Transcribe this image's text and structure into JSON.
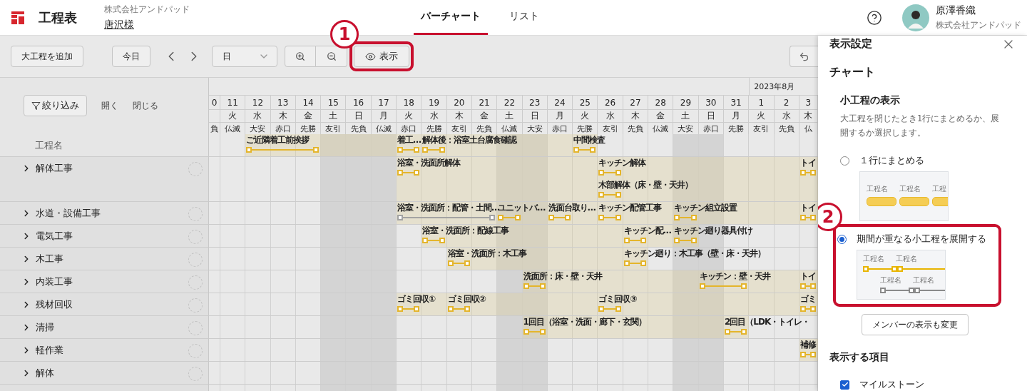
{
  "header": {
    "app_title": "工程表",
    "company": "株式会社アンドパッド",
    "project": "唐沢様",
    "tabs": [
      {
        "label": "バーチャート",
        "selected": true
      },
      {
        "label": "リスト",
        "selected": false
      }
    ],
    "user": {
      "name": "原澤香織",
      "company": "株式会社アンドパッド"
    }
  },
  "toolbar": {
    "add_button": "大工程を追加",
    "today_button": "今日",
    "scale": "日",
    "view_button": "表示"
  },
  "process_list": {
    "filter_button": "絞り込み",
    "expand": "開く",
    "collapse": "閉じる",
    "column_title": "工程名"
  },
  "days": [
    {
      "day": "0",
      "rokuyo": "負",
      "holiday": false
    },
    {
      "day": "11",
      "weekday": "火",
      "rokuyo": "仏滅",
      "holiday": false
    },
    {
      "day": "12",
      "weekday": "水",
      "rokuyo": "大安",
      "holiday": false
    },
    {
      "day": "13",
      "weekday": "木",
      "rokuyo": "赤口",
      "holiday": false
    },
    {
      "day": "14",
      "weekday": "金",
      "rokuyo": "先勝",
      "holiday": false
    },
    {
      "day": "15",
      "weekday": "土",
      "rokuyo": "友引",
      "holiday": true
    },
    {
      "day": "16",
      "weekday": "日",
      "rokuyo": "先負",
      "holiday": true
    },
    {
      "day": "17",
      "weekday": "月",
      "rokuyo": "仏滅",
      "holiday": true
    },
    {
      "day": "18",
      "weekday": "火",
      "rokuyo": "赤口",
      "holiday": false
    },
    {
      "day": "19",
      "weekday": "水",
      "rokuyo": "先勝",
      "holiday": false
    },
    {
      "day": "20",
      "weekday": "木",
      "rokuyo": "友引",
      "holiday": false
    },
    {
      "day": "21",
      "weekday": "金",
      "rokuyo": "先負",
      "holiday": false
    },
    {
      "day": "22",
      "weekday": "土",
      "rokuyo": "仏滅",
      "holiday": true
    },
    {
      "day": "23",
      "weekday": "日",
      "rokuyo": "大安",
      "holiday": true
    },
    {
      "day": "24",
      "weekday": "月",
      "rokuyo": "赤口",
      "holiday": false
    },
    {
      "day": "25",
      "weekday": "火",
      "rokuyo": "先勝",
      "holiday": false
    },
    {
      "day": "26",
      "weekday": "水",
      "rokuyo": "友引",
      "holiday": false
    },
    {
      "day": "27",
      "weekday": "木",
      "rokuyo": "先負",
      "holiday": false
    },
    {
      "day": "28",
      "weekday": "金",
      "rokuyo": "仏滅",
      "holiday": false
    },
    {
      "day": "29",
      "weekday": "土",
      "rokuyo": "大安",
      "holiday": true
    },
    {
      "day": "30",
      "weekday": "日",
      "rokuyo": "赤口",
      "holiday": true
    },
    {
      "day": "31",
      "weekday": "月",
      "rokuyo": "先勝",
      "holiday": false
    },
    {
      "day": "1",
      "weekday": "火",
      "rokuyo": "友引",
      "holiday": false,
      "month": "2023年8月"
    },
    {
      "day": "2",
      "weekday": "水",
      "rokuyo": "先負",
      "holiday": false
    },
    {
      "day": "3",
      "weekday": "木",
      "rokuyo": "仏",
      "holiday": false
    }
  ],
  "rows": [
    {
      "lanes": [
        [
          {
            "kind": "empty"
          },
          {
            "kind": "empty"
          },
          {
            "kind": "task",
            "label": "ご近隣着工前挨拶",
            "color": "#e4b52c"
          },
          {
            "kind": "cont"
          },
          {
            "kind": "cont"
          },
          {
            "kind": "empty"
          },
          {
            "kind": "empty"
          },
          {
            "kind": "empty"
          },
          {
            "kind": "task",
            "label": "着工…",
            "color": "#e4b52c"
          },
          {
            "kind": "task",
            "label": "解体後：浴室土台腐食確認",
            "color": "#e4b52c"
          },
          {
            "kind": "empty"
          },
          {
            "kind": "empty"
          },
          {
            "kind": "empty"
          },
          {
            "kind": "empty"
          },
          {
            "kind": "empty"
          },
          {
            "kind": "task",
            "label": "中間検査",
            "color": "#e4b52c"
          }
        ]
      ]
    },
    {
      "name": "解体工事",
      "expanded": false,
      "lanes": [
        [
          {
            "kind": "empty"
          },
          {
            "kind": "empty"
          },
          {
            "kind": "empty"
          },
          {
            "kind": "empty"
          },
          {
            "kind": "empty"
          },
          {
            "kind": "empty"
          },
          {
            "kind": "empty"
          },
          {
            "kind": "empty"
          },
          {
            "kind": "task",
            "label": "浴室・洗面所解体",
            "color": "#e4b52c"
          },
          {
            "kind": "empty"
          },
          {
            "kind": "empty"
          },
          {
            "kind": "empty"
          },
          {
            "kind": "empty"
          },
          {
            "kind": "empty"
          },
          {
            "kind": "empty"
          },
          {
            "kind": "empty"
          },
          {
            "kind": "task",
            "label": "キッチン解体",
            "color": "#e4b52c"
          },
          {
            "kind": "empty"
          },
          {
            "kind": "empty"
          },
          {
            "kind": "empty"
          },
          {
            "kind": "empty"
          },
          {
            "kind": "empty"
          },
          {
            "kind": "empty"
          },
          {
            "kind": "empty"
          },
          {
            "kind": "task",
            "label": "トイ",
            "color": "#e4b52c"
          }
        ],
        [
          {
            "kind": "empty"
          },
          {
            "kind": "empty"
          },
          {
            "kind": "empty"
          },
          {
            "kind": "empty"
          },
          {
            "kind": "empty"
          },
          {
            "kind": "empty"
          },
          {
            "kind": "empty"
          },
          {
            "kind": "empty"
          },
          {
            "kind": "empty"
          },
          {
            "kind": "empty"
          },
          {
            "kind": "empty"
          },
          {
            "kind": "empty"
          },
          {
            "kind": "empty"
          },
          {
            "kind": "empty"
          },
          {
            "kind": "empty"
          },
          {
            "kind": "empty"
          },
          {
            "kind": "task",
            "label": "木部解体（床・壁・天井）",
            "color": "#e4b52c"
          }
        ]
      ]
    },
    {
      "name": "水道・設備工事",
      "expanded": false,
      "lanes": [
        [
          {
            "kind": "empty"
          },
          {
            "kind": "empty"
          },
          {
            "kind": "empty"
          },
          {
            "kind": "empty"
          },
          {
            "kind": "empty"
          },
          {
            "kind": "empty"
          },
          {
            "kind": "empty"
          },
          {
            "kind": "empty"
          },
          {
            "kind": "task",
            "label": "浴室・洗面所：配管・土間…",
            "color": "#a3a3a3"
          },
          {
            "kind": "cont"
          },
          {
            "kind": "cont"
          },
          {
            "kind": "cont"
          },
          {
            "kind": "task",
            "label": "ユニットバ…",
            "color": "#e4b52c"
          },
          {
            "kind": "empty"
          },
          {
            "kind": "task",
            "label": "洗面台取り…",
            "color": "#e4b52c"
          },
          {
            "kind": "empty"
          },
          {
            "kind": "task",
            "label": "キッチン配管工事",
            "color": "#e4b52c"
          },
          {
            "kind": "empty"
          },
          {
            "kind": "empty"
          },
          {
            "kind": "task",
            "label": "キッチン組立設置",
            "color": "#e4b52c"
          },
          {
            "kind": "empty"
          },
          {
            "kind": "empty"
          },
          {
            "kind": "empty"
          },
          {
            "kind": "empty"
          },
          {
            "kind": "task",
            "label": "トイ",
            "color": "#e4b52c"
          }
        ]
      ]
    },
    {
      "name": "電気工事",
      "expanded": false,
      "lanes": [
        [
          {
            "kind": "empty"
          },
          {
            "kind": "empty"
          },
          {
            "kind": "empty"
          },
          {
            "kind": "empty"
          },
          {
            "kind": "empty"
          },
          {
            "kind": "empty"
          },
          {
            "kind": "empty"
          },
          {
            "kind": "empty"
          },
          {
            "kind": "empty"
          },
          {
            "kind": "task",
            "label": "浴室・洗面所：配線工事",
            "color": "#e4b52c"
          },
          {
            "kind": "empty"
          },
          {
            "kind": "empty"
          },
          {
            "kind": "empty"
          },
          {
            "kind": "empty"
          },
          {
            "kind": "empty"
          },
          {
            "kind": "empty"
          },
          {
            "kind": "empty"
          },
          {
            "kind": "task",
            "label": "キッチン配…",
            "color": "#e4b52c"
          },
          {
            "kind": "empty"
          },
          {
            "kind": "task",
            "label": "キッチン廻り器具付け",
            "color": "#e4b52c"
          }
        ]
      ]
    },
    {
      "name": "木工事",
      "expanded": false,
      "lanes": [
        [
          {
            "kind": "empty"
          },
          {
            "kind": "empty"
          },
          {
            "kind": "empty"
          },
          {
            "kind": "empty"
          },
          {
            "kind": "empty"
          },
          {
            "kind": "empty"
          },
          {
            "kind": "empty"
          },
          {
            "kind": "empty"
          },
          {
            "kind": "empty"
          },
          {
            "kind": "empty"
          },
          {
            "kind": "task",
            "label": "浴室・洗面所：木工事",
            "color": "#e4b52c"
          },
          {
            "kind": "empty"
          },
          {
            "kind": "empty"
          },
          {
            "kind": "empty"
          },
          {
            "kind": "empty"
          },
          {
            "kind": "empty"
          },
          {
            "kind": "empty"
          },
          {
            "kind": "task",
            "label": "キッチン廻り：木工事（壁・床・天井）",
            "color": "#e4b52c"
          }
        ]
      ]
    },
    {
      "name": "内装工事",
      "expanded": false,
      "lanes": [
        [
          {
            "kind": "empty"
          },
          {
            "kind": "empty"
          },
          {
            "kind": "empty"
          },
          {
            "kind": "empty"
          },
          {
            "kind": "empty"
          },
          {
            "kind": "empty"
          },
          {
            "kind": "empty"
          },
          {
            "kind": "empty"
          },
          {
            "kind": "empty"
          },
          {
            "kind": "empty"
          },
          {
            "kind": "empty"
          },
          {
            "kind": "empty"
          },
          {
            "kind": "empty"
          },
          {
            "kind": "task",
            "label": "洗面所：床・壁・天井",
            "color": "#e4b52c"
          },
          {
            "kind": "empty"
          },
          {
            "kind": "empty"
          },
          {
            "kind": "empty"
          },
          {
            "kind": "empty"
          },
          {
            "kind": "empty"
          },
          {
            "kind": "empty"
          },
          {
            "kind": "task",
            "label": "キッチン：壁・天井",
            "color": "#e4b52c"
          },
          {
            "kind": "cont"
          },
          {
            "kind": "empty"
          },
          {
            "kind": "empty"
          },
          {
            "kind": "task",
            "label": "トイ",
            "color": "#e4b52c"
          }
        ]
      ]
    },
    {
      "name": "残材回収",
      "expanded": false,
      "lanes": [
        [
          {
            "kind": "empty"
          },
          {
            "kind": "empty"
          },
          {
            "kind": "empty"
          },
          {
            "kind": "empty"
          },
          {
            "kind": "empty"
          },
          {
            "kind": "empty"
          },
          {
            "kind": "empty"
          },
          {
            "kind": "empty"
          },
          {
            "kind": "task",
            "label": "ゴミ回収①",
            "color": "#e4b52c"
          },
          {
            "kind": "empty"
          },
          {
            "kind": "task",
            "label": "ゴミ回収②",
            "color": "#e4b52c"
          },
          {
            "kind": "empty"
          },
          {
            "kind": "empty"
          },
          {
            "kind": "empty"
          },
          {
            "kind": "empty"
          },
          {
            "kind": "empty"
          },
          {
            "kind": "task",
            "label": "ゴミ回収③",
            "color": "#e4b52c"
          },
          {
            "kind": "empty"
          },
          {
            "kind": "empty"
          },
          {
            "kind": "empty"
          },
          {
            "kind": "empty"
          },
          {
            "kind": "empty"
          },
          {
            "kind": "empty"
          },
          {
            "kind": "empty"
          },
          {
            "kind": "task",
            "label": "ゴミ",
            "color": "#e4b52c"
          }
        ]
      ]
    },
    {
      "name": "清掃",
      "expanded": false,
      "lanes": [
        [
          {
            "kind": "empty"
          },
          {
            "kind": "empty"
          },
          {
            "kind": "empty"
          },
          {
            "kind": "empty"
          },
          {
            "kind": "empty"
          },
          {
            "kind": "empty"
          },
          {
            "kind": "empty"
          },
          {
            "kind": "empty"
          },
          {
            "kind": "empty"
          },
          {
            "kind": "empty"
          },
          {
            "kind": "empty"
          },
          {
            "kind": "empty"
          },
          {
            "kind": "empty"
          },
          {
            "kind": "task",
            "label": "1回目（浴室・洗面・廊下・玄関）",
            "color": "#e4b52c"
          },
          {
            "kind": "empty"
          },
          {
            "kind": "empty"
          },
          {
            "kind": "empty"
          },
          {
            "kind": "empty"
          },
          {
            "kind": "empty"
          },
          {
            "kind": "empty"
          },
          {
            "kind": "empty"
          },
          {
            "kind": "task",
            "label": "2回目（LDK・トイレ・",
            "color": "#e4b52c"
          }
        ]
      ]
    },
    {
      "name": "軽作業",
      "expanded": false,
      "lanes": [
        [
          {
            "kind": "empty"
          },
          {
            "kind": "empty"
          },
          {
            "kind": "empty"
          },
          {
            "kind": "empty"
          },
          {
            "kind": "empty"
          },
          {
            "kind": "empty"
          },
          {
            "kind": "empty"
          },
          {
            "kind": "empty"
          },
          {
            "kind": "empty"
          },
          {
            "kind": "empty"
          },
          {
            "kind": "empty"
          },
          {
            "kind": "empty"
          },
          {
            "kind": "empty"
          },
          {
            "kind": "empty"
          },
          {
            "kind": "empty"
          },
          {
            "kind": "empty"
          },
          {
            "kind": "empty"
          },
          {
            "kind": "empty"
          },
          {
            "kind": "empty"
          },
          {
            "kind": "empty"
          },
          {
            "kind": "empty"
          },
          {
            "kind": "empty"
          },
          {
            "kind": "empty"
          },
          {
            "kind": "empty"
          },
          {
            "kind": "task",
            "label": "補修",
            "color": "#e4b52c"
          }
        ]
      ]
    },
    {
      "name": "解体",
      "expanded": false
    }
  ],
  "display_panel": {
    "title": "表示設定",
    "section": "チャート",
    "subsection": "小工程の表示",
    "description": "大工程を閉じたとき1行にまとめるか、展開するか選択します。",
    "options": [
      {
        "kind": "collapsed",
        "label": "１行にまとめる",
        "selected": false,
        "preview_labels": [
          "工程名",
          "工程名",
          "工程"
        ]
      },
      {
        "kind": "expanded",
        "label": "期間が重なる小工程を展開する",
        "selected": true,
        "preview_labels": [
          "工程名",
          "工程名",
          "工程名",
          "工程名"
        ]
      }
    ],
    "member_button": "メンバーの表示も変更",
    "items_heading": "表示する項目",
    "items": [
      {
        "label": "マイルストーン",
        "checked": true
      }
    ]
  },
  "callouts": [
    {
      "number": "1"
    },
    {
      "number": "2"
    }
  ]
}
